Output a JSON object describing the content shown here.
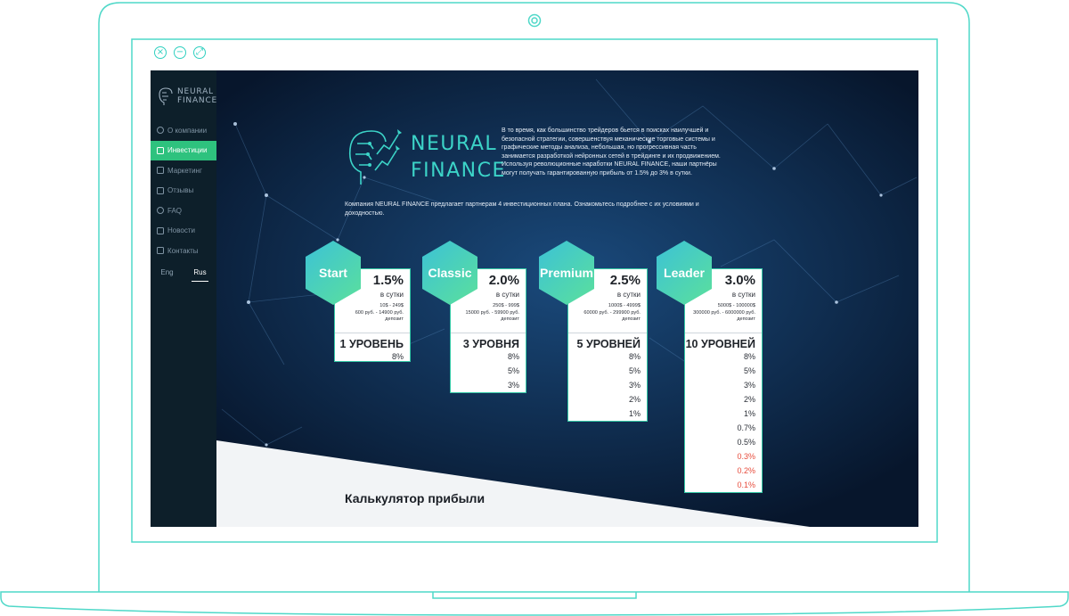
{
  "window_controls": {
    "close": "×",
    "minimize": "−",
    "maximize": "⤢"
  },
  "sidebar": {
    "logo_line1": "NEURAL",
    "logo_line2": "FINANCE",
    "items": [
      {
        "label": "О компании",
        "icon": "info-icon"
      },
      {
        "label": "Инвестиции",
        "icon": "briefcase-icon",
        "active": true
      },
      {
        "label": "Маркетинг",
        "icon": "chart-icon"
      },
      {
        "label": "Отзывы",
        "icon": "chat-icon"
      },
      {
        "label": "FAQ",
        "icon": "question-icon"
      },
      {
        "label": "Новости",
        "icon": "news-icon"
      },
      {
        "label": "Контакты",
        "icon": "contacts-icon"
      }
    ],
    "languages": [
      {
        "label": "Eng",
        "active": false
      },
      {
        "label": "Rus",
        "active": true
      }
    ]
  },
  "brand": {
    "line1": "NEURAL",
    "line2": "FINANCE"
  },
  "intro_text": "В то время, как большинство трейдеров бьется в поисках наилучшей и безопасной стратегии, совершенствуя механические торговые системы и графические методы анализа, небольшая, но прогрессивная часть занимается разработкой нейронных сетей в трейдинге и их продвижением. Используя революционные наработки NEURAL FINANCE, наши партнёры могут получать гарантированную прибыль от 1.5% до 3% в сутки.",
  "plans_text": "Компания NEURAL FINANCE предлагает партнерам 4 инвестиционных плана. Ознакомьтесь подробнее с их условиями и доходностью.",
  "plans": [
    {
      "name": "Start",
      "rate": "1.5%",
      "per": "в сутки",
      "cond1": "10$ - 249$",
      "cond2": "600 руб. - 14900 руб.",
      "cond3": "депозит",
      "levels": "1 УРОВЕНЬ",
      "percents": [
        "8%"
      ]
    },
    {
      "name": "Classic",
      "rate": "2.0%",
      "per": "в сутки",
      "cond1": "250$ - 999$",
      "cond2": "15000 руб. - 59900 руб.",
      "cond3": "депозит",
      "levels": "3 УРОВНЯ",
      "percents": [
        "8%",
        "5%",
        "3%"
      ]
    },
    {
      "name": "Premium",
      "rate": "2.5%",
      "per": "в сутки",
      "cond1": "1000$ - 4999$",
      "cond2": "60000 руб. - 299900 руб.",
      "cond3": "депозит",
      "levels": "5 УРОВНЕЙ",
      "percents": [
        "8%",
        "5%",
        "3%",
        "2%",
        "1%"
      ]
    },
    {
      "name": "Leader",
      "rate": "3.0%",
      "per": "в сутки",
      "cond1": "5000$ - 100000$",
      "cond2": "300000 руб. - 6000000 руб.",
      "cond3": "депозит",
      "levels": "10 УРОВНЕЙ",
      "percents": [
        "8%",
        "5%",
        "3%",
        "2%",
        "1%",
        "0.7%",
        "0.5%",
        "0.3%",
        "0.2%",
        "0.1%"
      ],
      "red_from": 7
    }
  ],
  "calculator": {
    "title": "Калькулятор прибыли"
  },
  "colors": {
    "accent": "#2ec27e",
    "teal": "#3cd4c8",
    "hero_bg": "#0b1d38",
    "sidebar_bg": "#0d1f2a",
    "red": "#e74c3c"
  }
}
